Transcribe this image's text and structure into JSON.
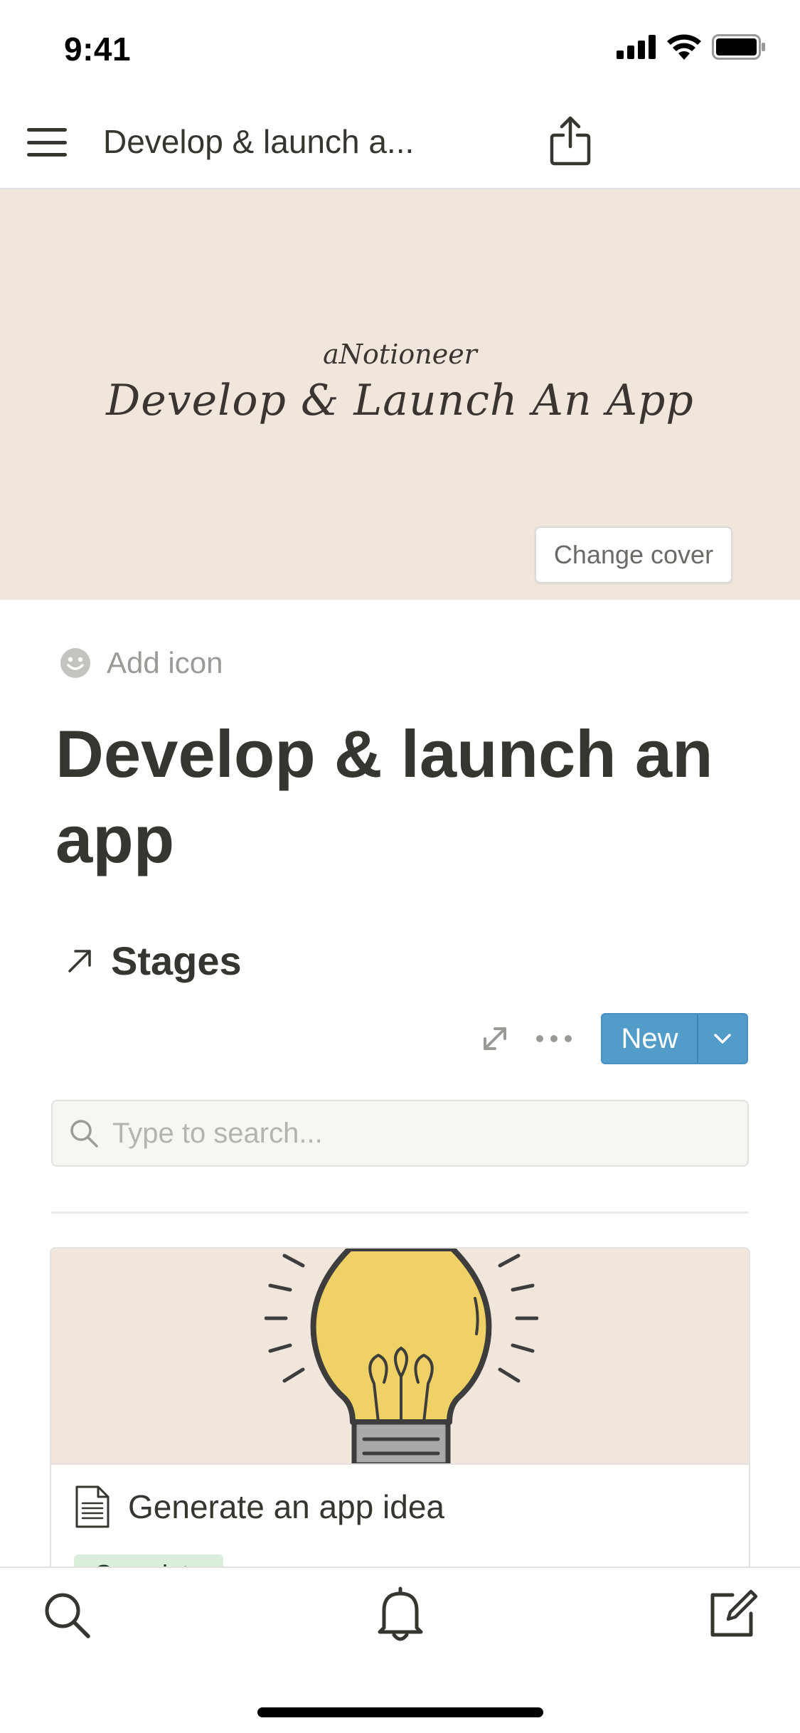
{
  "status_bar": {
    "time": "9:41",
    "icons": [
      "cellular-icon",
      "wifi-icon",
      "battery-icon"
    ]
  },
  "nav": {
    "title": "Develop & launch a...",
    "menu_icon": "hamburger-icon",
    "share_icon": "share-icon"
  },
  "cover": {
    "brand": "aNotioneer",
    "title": "Develop & Launch An App",
    "change_cover_label": "Change cover",
    "background": "#f1e6dc"
  },
  "page": {
    "add_icon_label": "Add icon",
    "title": "Develop & launch an app"
  },
  "linked_db": {
    "label": "Stages",
    "new_label": "New",
    "accent": "#529cca",
    "search": {
      "placeholder": "Type to search..."
    }
  },
  "cards": [
    {
      "title": "Generate an app idea",
      "tag": "Complete",
      "cover_icon": "lightbulb-icon",
      "tag_color": "#dbeddb"
    }
  ],
  "bottom_bar": {
    "tabs": [
      "search-icon",
      "bell-icon",
      "compose-icon"
    ]
  }
}
